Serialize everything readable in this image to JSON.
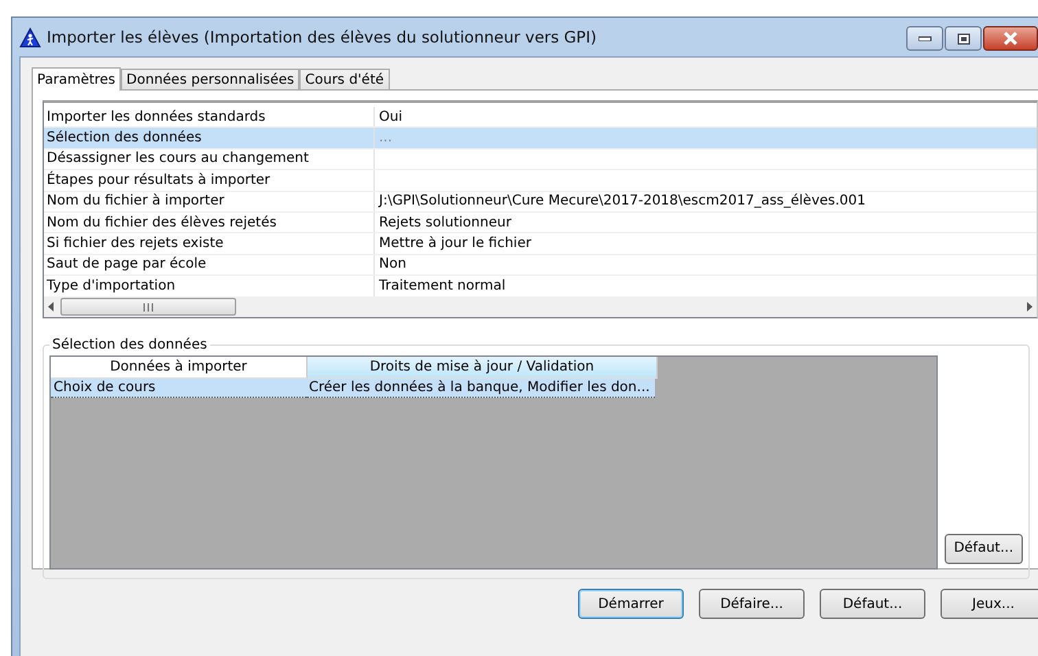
{
  "window": {
    "title": "Importer les élèves (Importation des élèves du solutionneur vers GPI)"
  },
  "tabs": [
    {
      "label": "Paramètres",
      "selected": true
    },
    {
      "label": "Données personnalisées",
      "selected": false
    },
    {
      "label": "Cours d'été",
      "selected": false
    }
  ],
  "properties": [
    {
      "name": "Importer les données standards",
      "value": "Oui",
      "selected": false
    },
    {
      "name": "Sélection des données",
      "value": "...",
      "selected": true
    },
    {
      "name": "Désassigner les cours au changement",
      "selected": false
    },
    {
      "name": "Étapes pour résultats à importer",
      "selected": false
    },
    {
      "name": "Nom du fichier à importer",
      "value": "J:\\GPI\\Solutionneur\\Cure Mecure\\2017-2018\\escm2017_ass_élèves.001",
      "selected": false
    },
    {
      "name": "Nom du fichier des élèves rejetés",
      "value": "Rejets solutionneur",
      "selected": false
    },
    {
      "name": "Si fichier des rejets existe",
      "value": "Mettre à jour le fichier",
      "selected": false
    },
    {
      "name": "Saut de page par école",
      "value": "Non",
      "selected": false
    },
    {
      "name": "Type d'importation",
      "value": "Traitement normal",
      "selected": false
    }
  ],
  "selection_group": {
    "title": "Sélection des données",
    "columns": [
      "Données à importer",
      "Droits de mise à jour / Validation"
    ],
    "rows": [
      {
        "cells": [
          "Choix de cours",
          "Créer les données à la banque, Modifier les don..."
        ],
        "selected": true
      }
    ],
    "button": "Défaut..."
  },
  "buttons": [
    "Démarrer",
    "Défaire...",
    "Défaut...",
    "Jeux..."
  ]
}
